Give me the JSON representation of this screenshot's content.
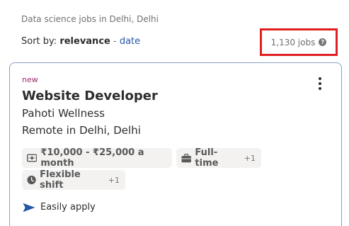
{
  "header": {
    "heading": "Data science jobs in Delhi, Delhi",
    "sort_label": "Sort by:",
    "sort_active": "relevance",
    "sort_separator": "-",
    "sort_alternative": "date",
    "job_count": "1,130 jobs",
    "help_icon": "question-circle-icon"
  },
  "job_card": {
    "tag": "new",
    "title": "Website Developer",
    "company": "Pahoti Wellness",
    "location": "Remote in Delhi, Delhi",
    "chips": [
      {
        "icon": "money-icon",
        "label": "₹10,000 - ₹25,000 a month",
        "more": ""
      },
      {
        "icon": "briefcase-icon",
        "label": "Full-time",
        "more": "+1"
      },
      {
        "icon": "clock-icon",
        "label": "Flexible shift",
        "more": "+1"
      }
    ],
    "apply_icon": "send-arrow-icon",
    "apply_label": "Easily apply",
    "menu_icon": "kebab-menu-icon"
  },
  "colors": {
    "accent_link": "#2557a7",
    "highlight_box": "#e02020",
    "new_tag": "#9d2b6b",
    "apply_icon": "#2557a7"
  }
}
